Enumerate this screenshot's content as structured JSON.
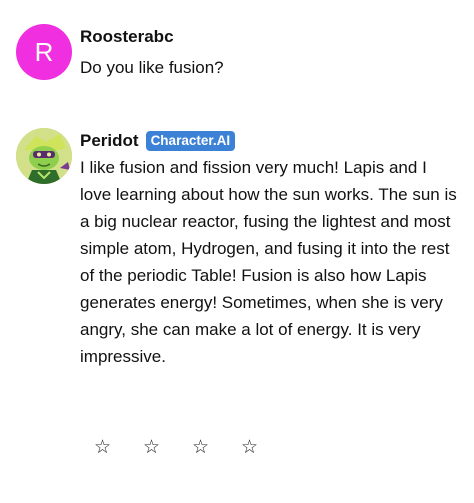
{
  "messages": [
    {
      "author": "Roosterabc",
      "avatar_letter": "R",
      "avatar_color": "#ef2fe0",
      "text": "Do you like fusion?"
    },
    {
      "author": "Peridot",
      "badge": "Character.AI",
      "badge_color": "#3b82d6",
      "avatar_icon": "peridot-character-avatar",
      "text": "I like fusion and fission very much! Lapis and I love learning about how the sun works. The sun is a big nuclear reactor, fusing the lightest and most simple atom, Hydrogen, and fusing it into the rest of the periodic Table! Fusion is also how Lapis generates energy! Sometimes, when she is very angry, she can make a lot of energy. It is very impressive."
    }
  ],
  "rating": {
    "stars": [
      "☆",
      "☆",
      "☆",
      "☆"
    ],
    "value": 0,
    "max": 4
  }
}
